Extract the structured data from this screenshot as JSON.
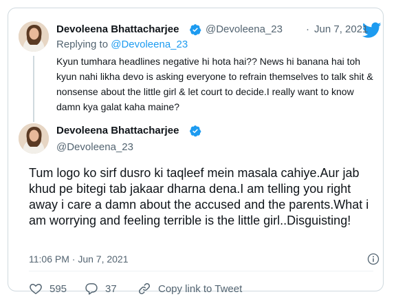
{
  "colors": {
    "accent": "#1d9bf0",
    "text": "#0f1419",
    "muted": "#536471",
    "border": "#cfd9de"
  },
  "reply_tweet": {
    "name": "Devoleena Bhattacharjee",
    "handle": "@Devoleena_23",
    "separator": "·",
    "date": "Jun 7, 2021",
    "replying_prefix": "Replying to ",
    "replying_to": "@Devoleena_23",
    "text": "Kyun tumhara headlines negative hi hota hai?? News hi banana hai toh kyun nahi likha devo is asking everyone to refrain themselves to talk shit & nonsense about the little girl & let court to decide.I really want to know damn kya galat kaha maine?"
  },
  "main_tweet": {
    "name": "Devoleena Bhattacharjee",
    "handle": "@Devoleena_23",
    "text": "Tum logo ko sirf dusro ki taqleef mein masala cahiye.Aur jab khud pe bitegi tab jakaar dharna dena.I am telling you right away i care a damn about the accused and the parents.What i am worrying and feeling terrible is the little girl..Disguisting!",
    "timestamp": "11:06 PM · Jun 7, 2021",
    "likes": "595",
    "replies": "37",
    "share_label": "Copy link to Tweet"
  },
  "icons": [
    "twitter-bird-icon",
    "verified-badge-icon",
    "info-icon",
    "heart-icon",
    "reply-bubble-icon",
    "link-icon"
  ]
}
